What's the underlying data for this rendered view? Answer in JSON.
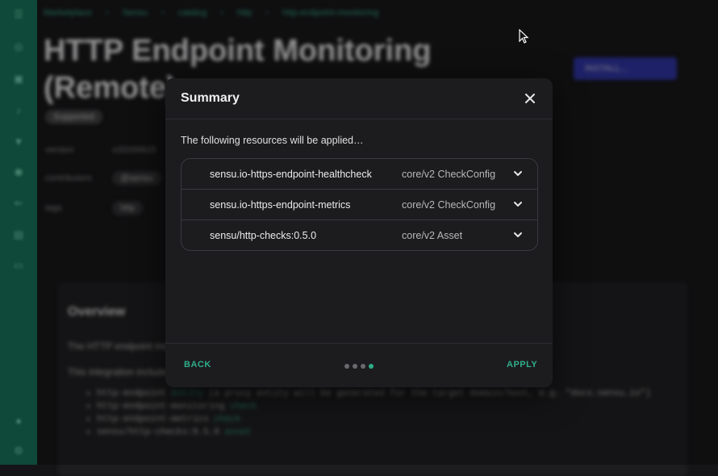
{
  "background": {
    "breadcrumbs": [
      "Marketplace",
      "Sensu",
      "catalog",
      "http",
      "http-endpoint-monitoring"
    ],
    "title_line1": "HTTP Endpoint Monitoring",
    "title_line2": "(Remote)",
    "badge": "Supported",
    "meta": [
      {
        "label": "version",
        "value": "v20200615"
      },
      {
        "label": "contributors",
        "value": "@sensu"
      },
      {
        "label": "tags",
        "value": "http"
      }
    ],
    "install_label": "INSTALL...",
    "overview_title": "Overview",
    "overview_text": "The HTTP endpoint monitoring integration checks the health and response of remote HTTP endpoints.",
    "overview_includes": "This integration includes:",
    "overview_items": [
      {
        "code": "http-endpoint",
        "kind": "entity",
        "text": "(a proxy entity will be generated for the target domain/host, e.g. \"docs.sensu.io\")"
      },
      {
        "code": "http-endpoint-monitoring",
        "kind": "check",
        "text": ""
      },
      {
        "code": "http-endpoint-metrics",
        "kind": "check",
        "text": ""
      },
      {
        "code": "sensu/http-checks:0.5.0",
        "kind": "asset",
        "text": ""
      }
    ]
  },
  "modal": {
    "title": "Summary",
    "intro": "The following resources will be applied…",
    "resources": [
      {
        "name": "sensu.io-https-endpoint-healthcheck",
        "type": "core/v2 CheckConfig"
      },
      {
        "name": "sensu.io-https-endpoint-metrics",
        "type": "core/v2 CheckConfig"
      },
      {
        "name": "sensu/http-checks:0.5.0",
        "type": "core/v2 Asset"
      }
    ],
    "back_label": "BACK",
    "apply_label": "APPLY",
    "step_total": 4,
    "step_current": 4
  },
  "colors": {
    "accent": "#2fae85",
    "sidebar": "#14664f",
    "modal_bg": "#1c1c1f"
  }
}
